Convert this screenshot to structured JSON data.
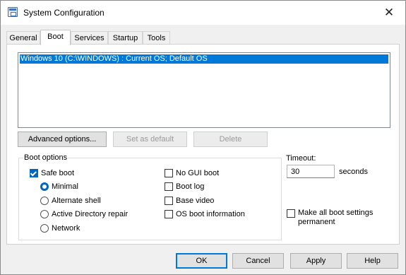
{
  "window": {
    "title": "System Configuration",
    "close_glyph": "✕"
  },
  "tabs": [
    {
      "label": "General"
    },
    {
      "label": "Boot"
    },
    {
      "label": "Services"
    },
    {
      "label": "Startup"
    },
    {
      "label": "Tools"
    }
  ],
  "active_tab": "Boot",
  "os_list": {
    "items": [
      "Windows 10 (C:\\WINDOWS) : Current OS; Default OS"
    ],
    "selected_index": 0
  },
  "buttons": {
    "advanced": "Advanced options...",
    "set_default": "Set as default",
    "delete": "Delete",
    "ok": "OK",
    "cancel": "Cancel",
    "apply": "Apply",
    "help": "Help"
  },
  "boot_options": {
    "label": "Boot options",
    "safe_boot": {
      "label": "Safe boot",
      "checked": true
    },
    "radios": [
      {
        "label": "Minimal",
        "checked": true
      },
      {
        "label": "Alternate shell",
        "checked": false
      },
      {
        "label": "Active Directory repair",
        "checked": false
      },
      {
        "label": "Network",
        "checked": false
      }
    ],
    "checkboxes": [
      {
        "label": "No GUI boot",
        "checked": false
      },
      {
        "label": "Boot log",
        "checked": false
      },
      {
        "label": "Base video",
        "checked": false
      },
      {
        "label": "OS boot information",
        "checked": false
      }
    ]
  },
  "timeout": {
    "label": "Timeout:",
    "value": "30",
    "unit": "seconds"
  },
  "make_permanent": {
    "label_line1": "Make all boot settings",
    "label_line2": "permanent",
    "checked": false
  },
  "colors": {
    "accent": "#0067c0",
    "selection": "#0078d7",
    "desktop": "#3a6fd6"
  },
  "icons": {
    "title": "system-configuration-icon",
    "close": "close-icon"
  }
}
